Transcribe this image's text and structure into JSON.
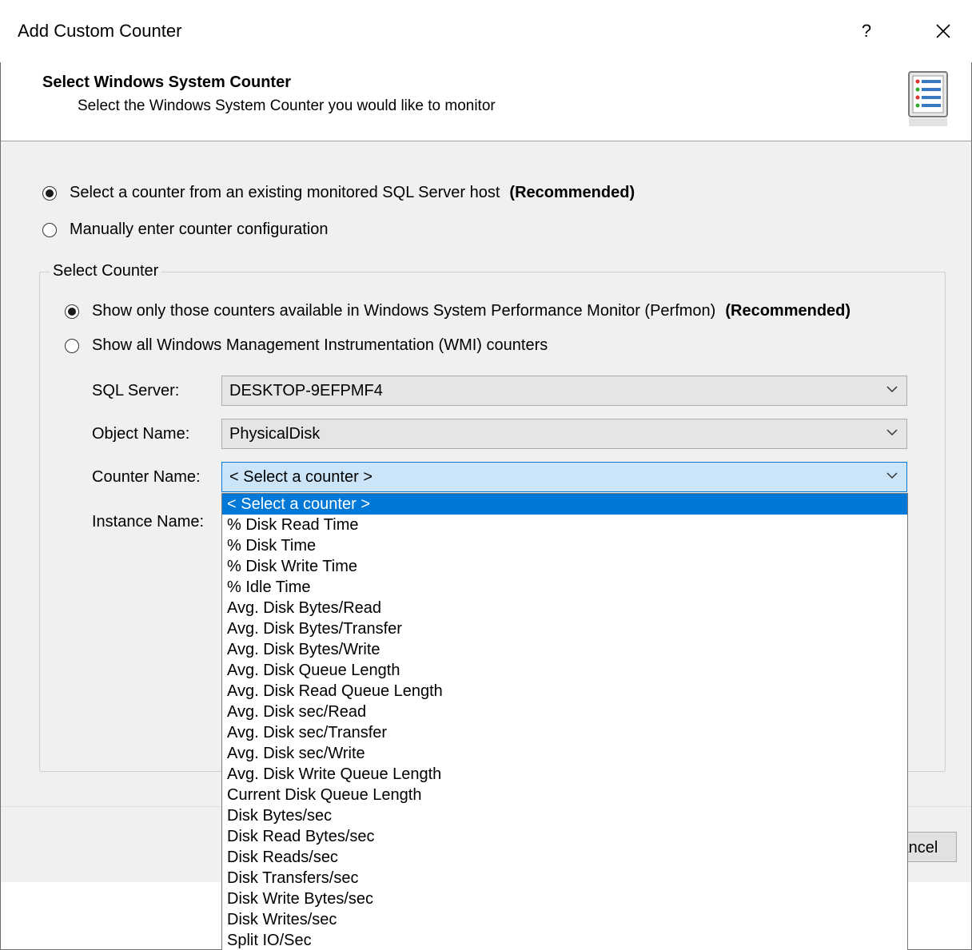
{
  "window": {
    "title": "Add Custom Counter",
    "help_label": "?",
    "close_label": "✕"
  },
  "header": {
    "title": "Select Windows System Counter",
    "subtitle": "Select the Windows System Counter you would like to monitor",
    "icon": "counter-list-icon"
  },
  "source_options": [
    {
      "label": "Select a counter from an existing monitored SQL Server host",
      "suffix": "(Recommended)",
      "selected": true
    },
    {
      "label": "Manually enter counter configuration",
      "suffix": "",
      "selected": false
    }
  ],
  "select_counter": {
    "legend": "Select Counter",
    "options": [
      {
        "label": "Show only those counters available in Windows System Performance Monitor (Perfmon)",
        "suffix": "(Recommended)",
        "selected": true
      },
      {
        "label": "Show all Windows Management Instrumentation (WMI) counters",
        "suffix": "",
        "selected": false
      }
    ],
    "fields": {
      "sql_server": {
        "label": "SQL Server:",
        "value": "DESKTOP-9EFPMF4"
      },
      "object_name": {
        "label": "Object Name:",
        "value": "PhysicalDisk"
      },
      "counter_name": {
        "label": "Counter Name:",
        "value": "< Select a counter >"
      },
      "instance_name": {
        "label": "Instance Name:"
      }
    }
  },
  "counter_dropdown": {
    "selected_index": 0,
    "items": [
      "< Select a counter >",
      "% Disk Read Time",
      "% Disk Time",
      "% Disk Write Time",
      "% Idle Time",
      "Avg. Disk Bytes/Read",
      "Avg. Disk Bytes/Transfer",
      "Avg. Disk Bytes/Write",
      "Avg. Disk Queue Length",
      "Avg. Disk Read Queue Length",
      "Avg. Disk sec/Read",
      "Avg. Disk sec/Transfer",
      "Avg. Disk sec/Write",
      "Avg. Disk Write Queue Length",
      "Current Disk Queue Length",
      "Disk Bytes/sec",
      "Disk Read Bytes/sec",
      "Disk Reads/sec",
      "Disk Transfers/sec",
      "Disk Write Bytes/sec",
      "Disk Writes/sec",
      "Split IO/Sec"
    ]
  },
  "footer": {
    "cancel_label": "Cancel"
  },
  "colors": {
    "selection": "#0078d7",
    "panel": "#f0f0f0",
    "combo_bg": "#e5e5e5",
    "combo_active": "#cce4f7"
  }
}
